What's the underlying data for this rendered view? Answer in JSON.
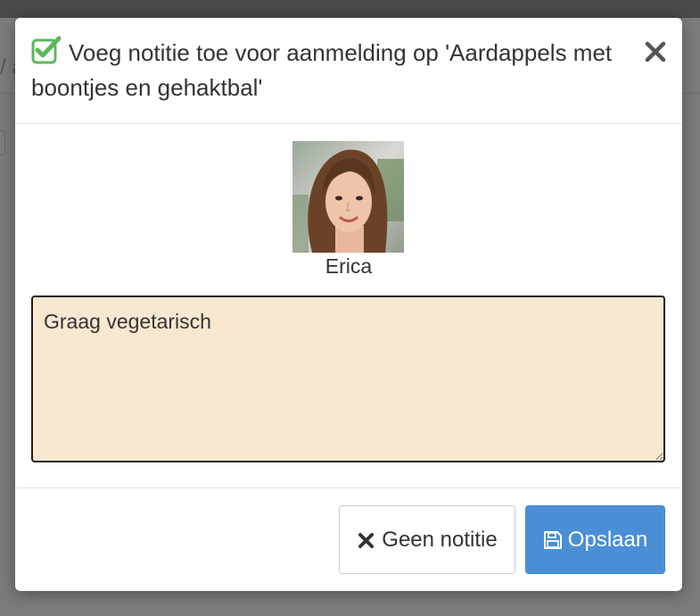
{
  "background": {
    "partial_text": "/ a"
  },
  "modal": {
    "title": "Voeg notitie toe voor aanmelding op 'Aardappels met boontjes en gehaktbal'",
    "close_label": "×",
    "title_icon": "check-square-icon",
    "accent_color": "#5cb85c"
  },
  "user": {
    "name": "Erica",
    "avatar_icon": "user-photo"
  },
  "note": {
    "value": "Graag vegetarisch",
    "background_color": "#f9e8d0"
  },
  "footer": {
    "cancel_label": "Geen notitie",
    "cancel_icon": "times-icon",
    "save_label": "Opslaan",
    "save_icon": "floppy-disk-icon",
    "save_color": "#4a8fd6"
  }
}
